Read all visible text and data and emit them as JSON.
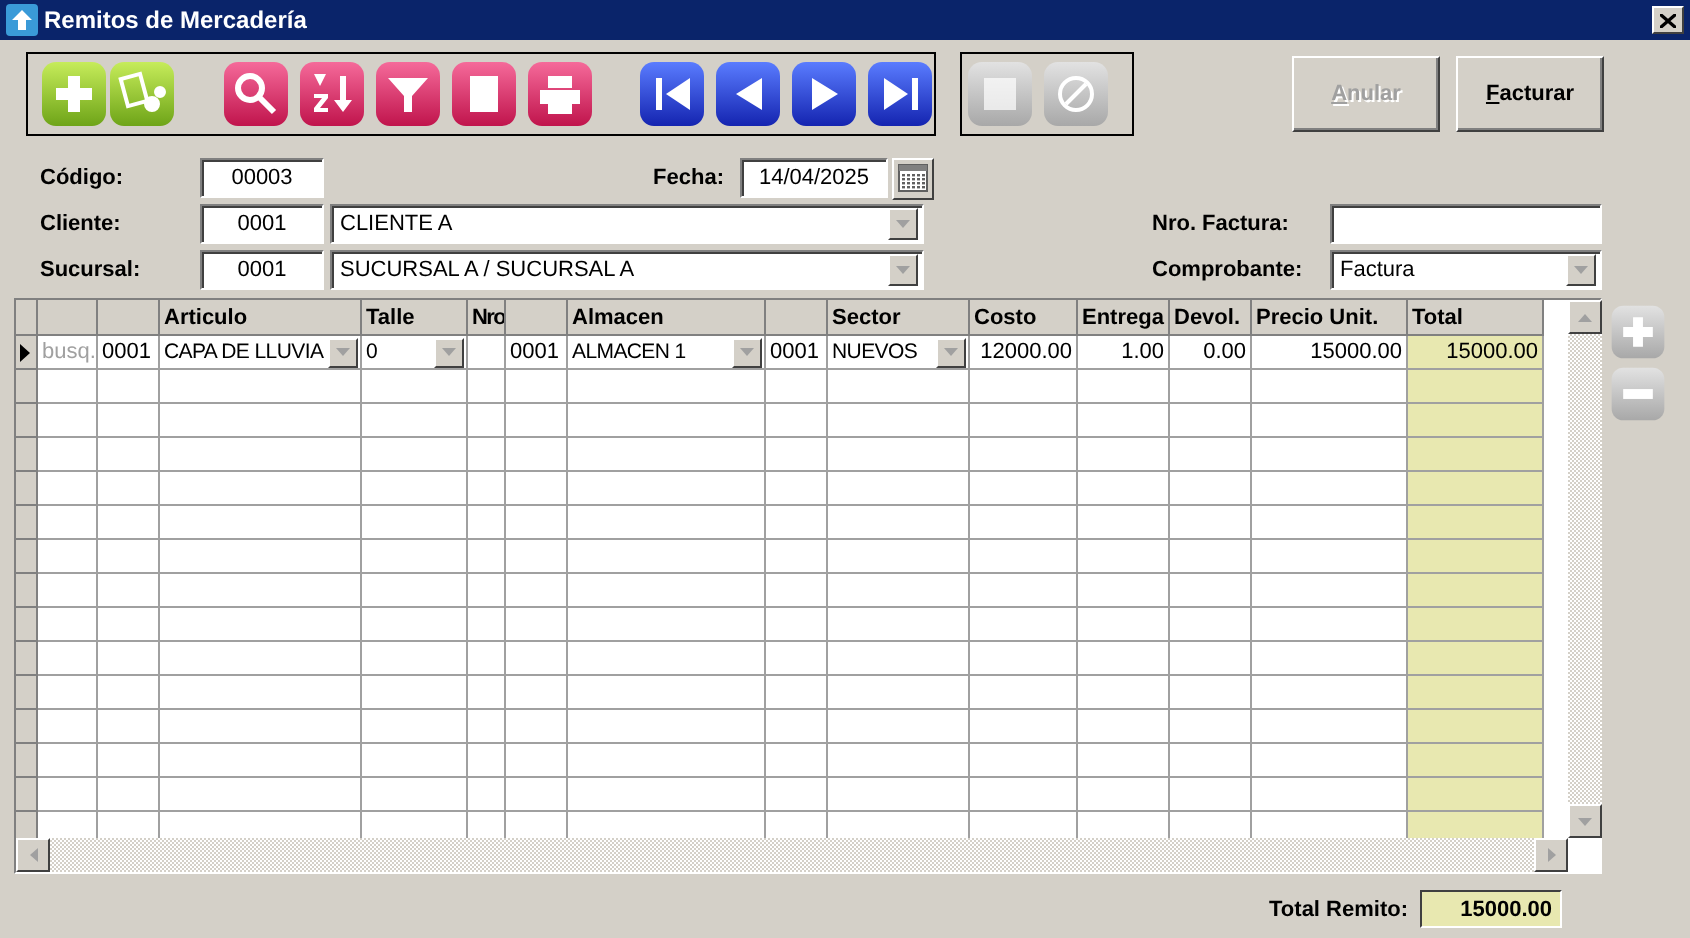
{
  "window": {
    "title": "Remitos de Mercadería"
  },
  "toolbar": [
    {
      "kind": "add",
      "disabled": false
    },
    {
      "kind": "images",
      "disabled": false
    },
    {
      "kind": "search",
      "disabled": false
    },
    {
      "kind": "sort",
      "disabled": false
    },
    {
      "kind": "filter",
      "disabled": false
    },
    {
      "kind": "notes",
      "disabled": false
    },
    {
      "kind": "print",
      "disabled": false
    },
    {
      "kind": "first",
      "disabled": false
    },
    {
      "kind": "prev",
      "disabled": false
    },
    {
      "kind": "next",
      "disabled": false
    },
    {
      "kind": "last",
      "disabled": false
    },
    {
      "kind": "save",
      "disabled": true
    },
    {
      "kind": "cancel",
      "disabled": true
    }
  ],
  "buttons": [
    {
      "label": "Anular",
      "disabled": true
    },
    {
      "label": "Facturar",
      "disabled": false
    }
  ],
  "form": {
    "codigo": {
      "label": "Código:",
      "value": "00003"
    },
    "fecha": {
      "label": "Fecha:",
      "value": "14/04/2025"
    },
    "cliente": {
      "label": "Cliente:",
      "code": "0001",
      "value": "CLIENTE A"
    },
    "sucursal": {
      "label": "Sucursal:",
      "code": "0001",
      "value": "SUCURSAL A / SUCURSAL A"
    },
    "nro_factura": {
      "label": "Nro. Factura:"
    },
    "comprobante": {
      "label": "Comprobante:",
      "value": "Factura"
    }
  },
  "table": {
    "columns": [
      {
        "kind": "text"
      },
      {
        "kind": "text"
      },
      {
        "label": "Articulo",
        "kind": "combo"
      },
      {
        "label": "Talle",
        "kind": "combo"
      },
      {
        "label": "Nro",
        "kind": "text"
      },
      {
        "kind": "text"
      },
      {
        "label": "Almacen",
        "kind": "combo"
      },
      {
        "kind": "text"
      },
      {
        "label": "Sector",
        "kind": "combo"
      },
      {
        "label": "Costo",
        "kind": "number"
      },
      {
        "label": "Entrega",
        "kind": "number"
      },
      {
        "label": "Devol.",
        "kind": "number"
      },
      {
        "label": "Precio Unit.",
        "kind": "number"
      },
      {
        "label": "Total",
        "kind": "total"
      }
    ],
    "rows": [
      {
        "selected": true,
        "cells": [
          "busq.",
          "0001",
          "CAPA DE LLUVIA",
          "0",
          null,
          "0001",
          "ALMACEN 1",
          "0001",
          "NUEVOS",
          "12000.00",
          "1.00",
          "0.00",
          "15000.00",
          "15000.00"
        ]
      }
    ]
  },
  "side_buttons": [
    {
      "kind": "add",
      "disabled": true
    },
    {
      "kind": "remove",
      "disabled": true
    }
  ],
  "footer": {
    "label": "Total Remito:",
    "value": "15000.00"
  }
}
